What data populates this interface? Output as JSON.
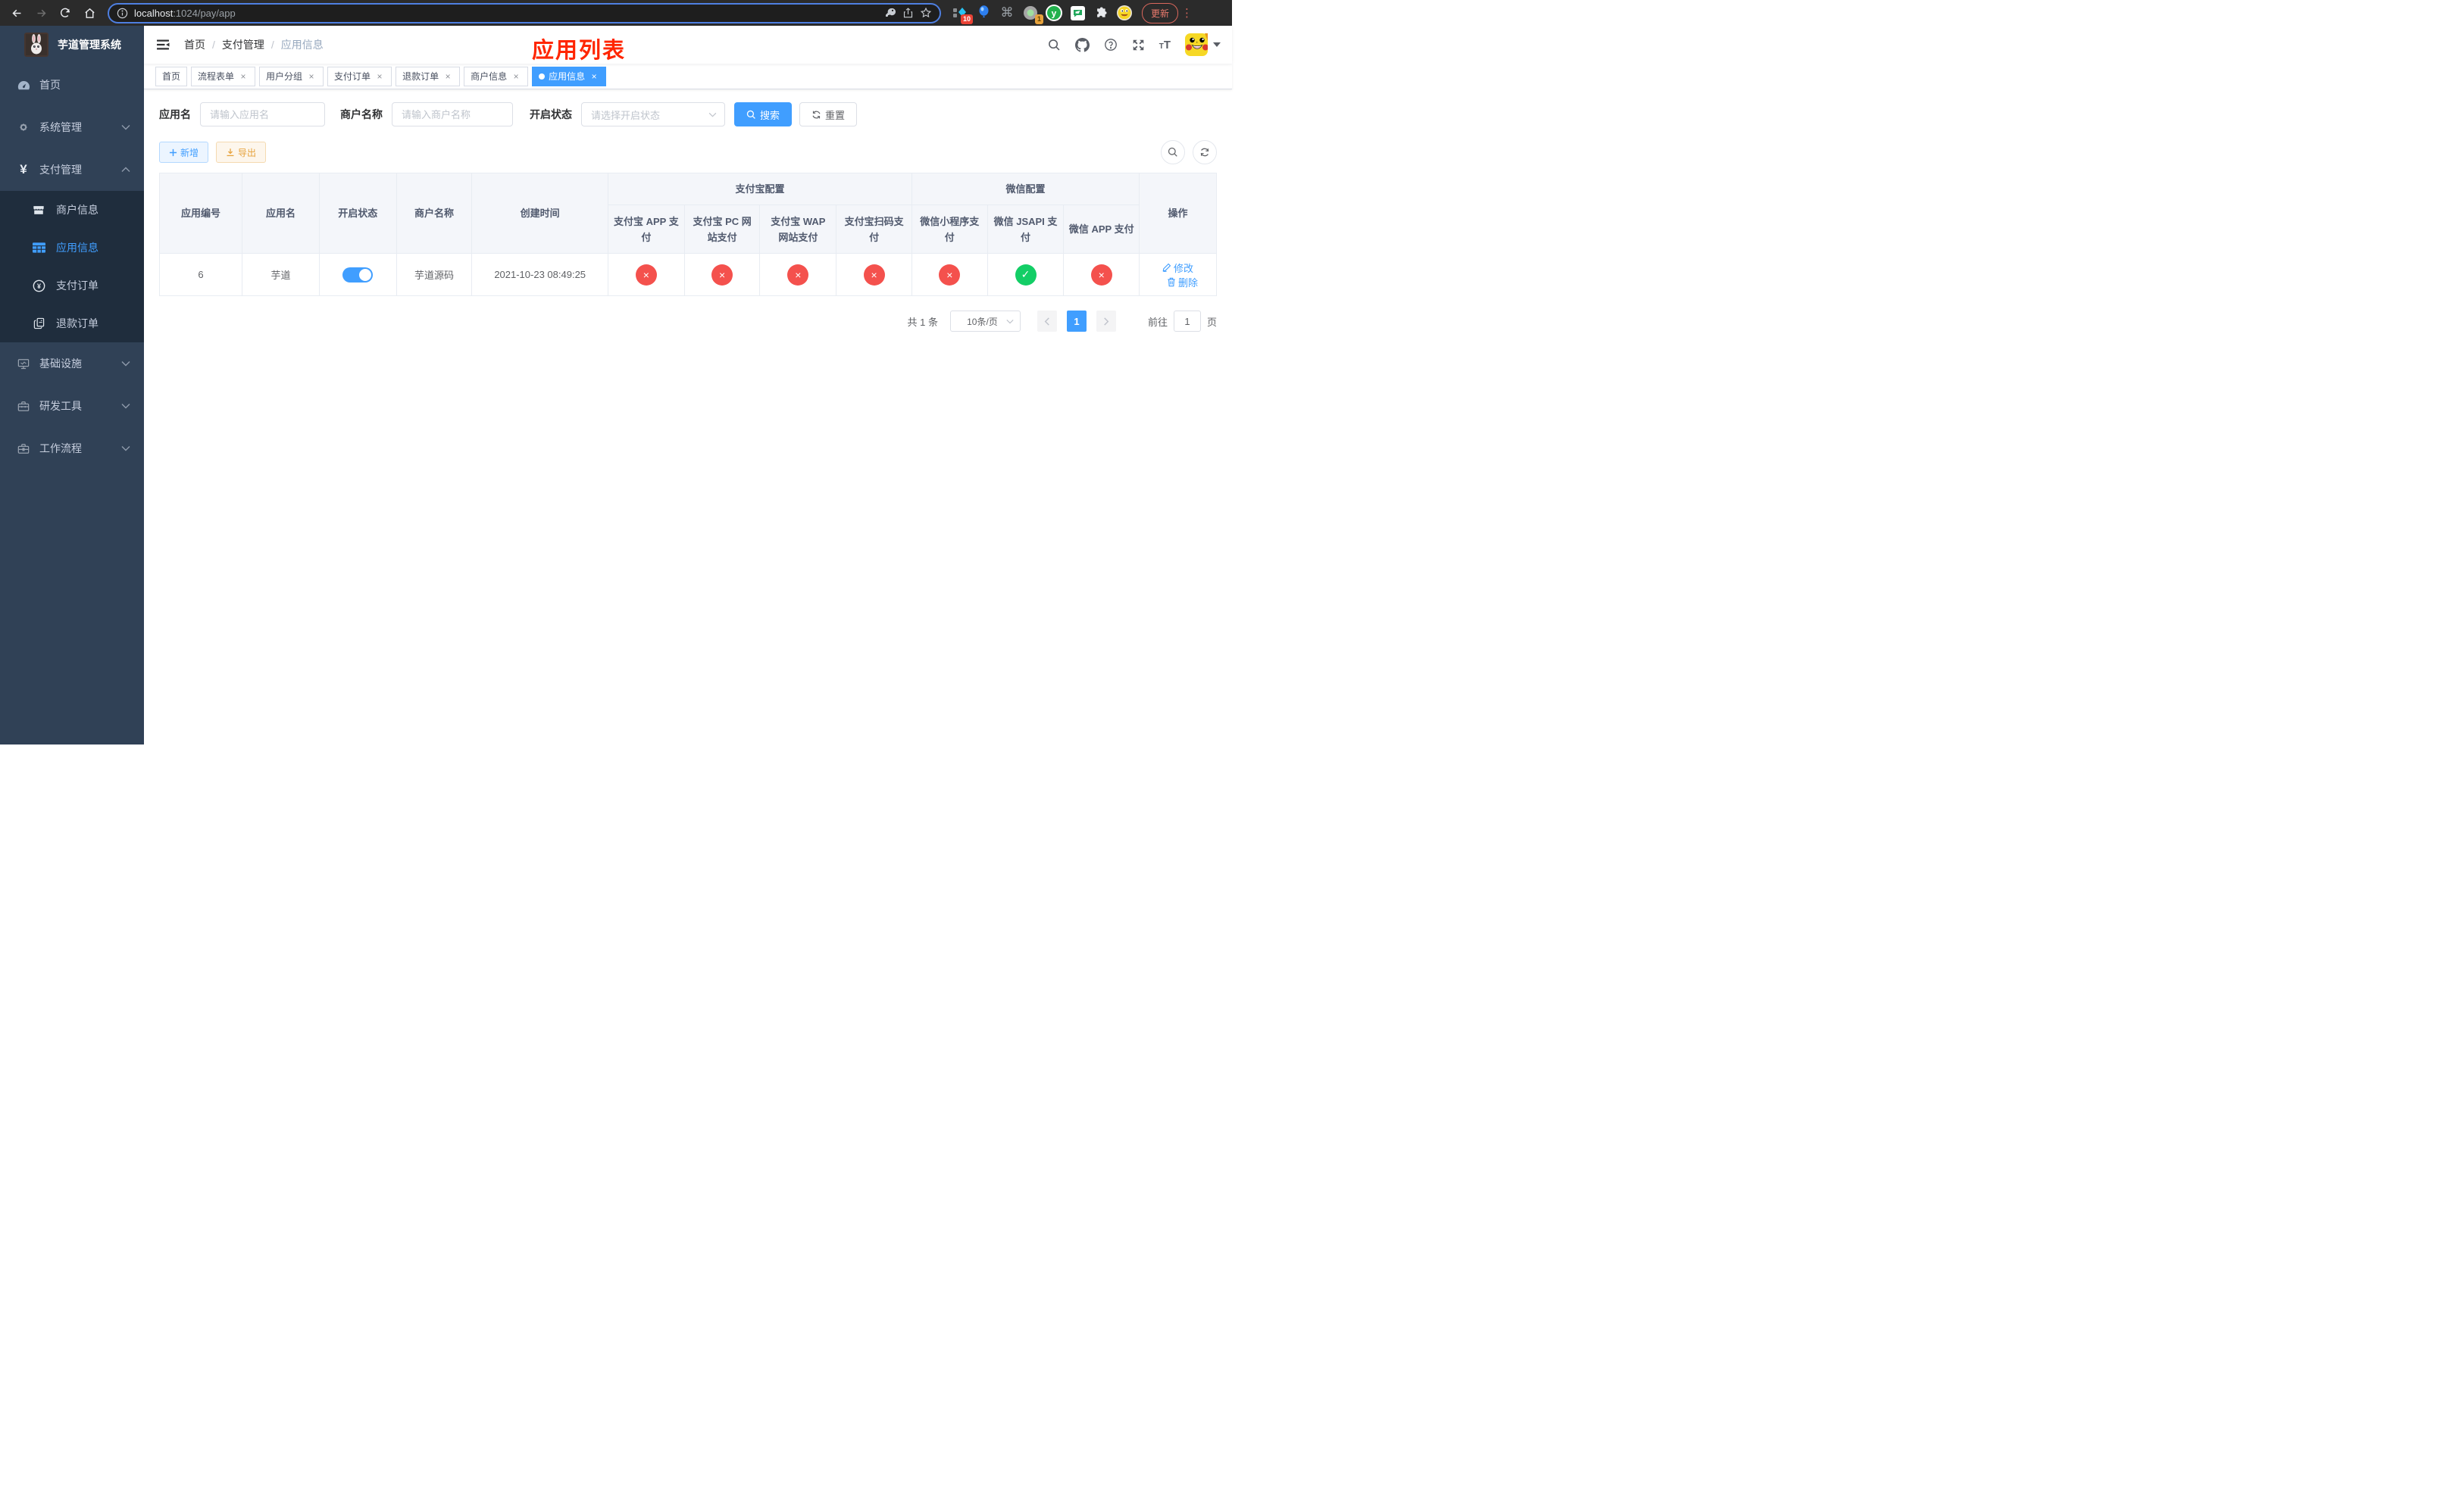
{
  "browser": {
    "url_host": "localhost",
    "url_rest": ":1024/pay/app",
    "update_label": "更新",
    "ext_badge_pin": "10",
    "ext_badge_rec": "1"
  },
  "icons": {
    "close": "×",
    "status_ok": "✓",
    "status_fail": "×",
    "kebab": "⋮",
    "cmd": "⌘"
  },
  "colors": {
    "primary": "#409eff",
    "success": "#13ce66",
    "danger": "#f4514d",
    "warning": "#e6a23c",
    "sidebar_bg": "#304156",
    "submenu_bg": "#1f2d3d",
    "annotation": "#ff2600"
  },
  "sidebar": {
    "logo_title": "芋道管理系统",
    "home": "首页",
    "system": "系统管理",
    "payment": "支付管理",
    "pay_children": [
      "商户信息",
      "应用信息",
      "支付订单",
      "退款订单"
    ],
    "infra": "基础设施",
    "devtools": "研发工具",
    "workflow": "工作流程"
  },
  "navbar": {
    "breadcrumb": [
      "首页",
      "支付管理",
      "应用信息"
    ],
    "annotation": "应用列表"
  },
  "tabs": {
    "items": [
      {
        "label": "首页"
      },
      {
        "label": "流程表单"
      },
      {
        "label": "用户分组"
      },
      {
        "label": "支付订单"
      },
      {
        "label": "退款订单"
      },
      {
        "label": "商户信息"
      },
      {
        "label": "应用信息"
      }
    ]
  },
  "filters": {
    "app_name_label": "应用名",
    "app_name_placeholder": "请输入应用名",
    "merchant_label": "商户名称",
    "merchant_placeholder": "请输入商户名称",
    "status_label": "开启状态",
    "status_placeholder": "请选择开启状态",
    "search_label": "搜索",
    "reset_label": "重置"
  },
  "toolbar": {
    "add_label": "新增",
    "export_label": "导出"
  },
  "table": {
    "columns": {
      "id": "应用编号",
      "name": "应用名",
      "status": "开启状态",
      "merchant": "商户名称",
      "created": "创建时间",
      "alipay_group": "支付宝配置",
      "wechat_group": "微信配置",
      "alipay": [
        "支付宝 APP 支付",
        "支付宝 PC 网站支付",
        "支付宝 WAP 网站支付",
        "支付宝扫码支付"
      ],
      "wechat": [
        "微信小程序支付",
        "微信 JSAPI 支付",
        "微信 APP 支付"
      ],
      "op": "操作"
    },
    "rows": [
      {
        "id": "6",
        "name": "芋道",
        "enabled": true,
        "merchant": "芋道源码",
        "created": "2021-10-23 08:49:25",
        "statuses": [
          "error",
          "error",
          "error",
          "error",
          "error",
          "success",
          "error"
        ],
        "edit_label": "修改",
        "delete_label": "删除"
      }
    ]
  },
  "pagination": {
    "total_text": "共 1 条",
    "page_size": "10条/页",
    "current_page": "1",
    "goto_label": "前往",
    "goto_value": "1",
    "page_suffix": "页"
  }
}
